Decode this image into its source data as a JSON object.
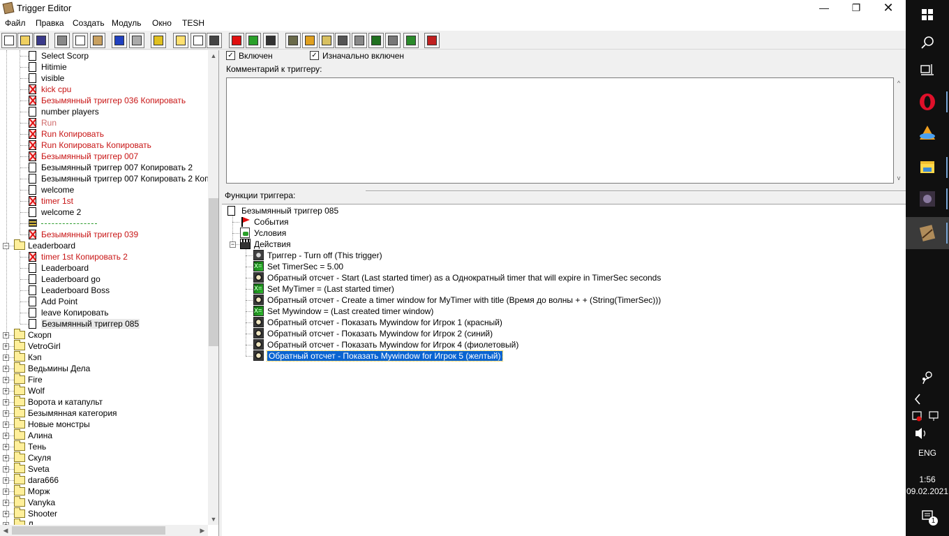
{
  "window": {
    "title": "Trigger Editor",
    "controls": {
      "minimize": "—",
      "maximize": "❐",
      "close": "✕"
    }
  },
  "menu": [
    "Файл",
    "Правка",
    "Создать",
    "Модуль",
    "Окно",
    "TESH"
  ],
  "toolbar": [
    "new",
    "open",
    "save",
    "cut",
    "copy",
    "paste",
    "undo",
    "redo",
    "delete",
    "new-category",
    "new-trigger",
    "new-comment",
    "new-event",
    "new-condition",
    "new-action",
    "terrain-editor",
    "trigger-editor",
    "sound-editor",
    "object-editor",
    "campaign-editor",
    "ai-editor",
    "object-manager",
    "import-manager",
    "test-map"
  ],
  "tree": {
    "items": [
      {
        "label": "Select Scorp",
        "type": "trigger",
        "depth": 2
      },
      {
        "label": "Hitimie",
        "type": "trigger",
        "depth": 2
      },
      {
        "label": "visible",
        "type": "trigger",
        "depth": 2
      },
      {
        "label": "kick cpu",
        "type": "trigger-off",
        "depth": 2
      },
      {
        "label": "Безымянный триггер 036 Копировать",
        "type": "trigger-off",
        "depth": 2
      },
      {
        "label": "number players",
        "type": "trigger",
        "depth": 2
      },
      {
        "label": "Run",
        "type": "trigger-disabled",
        "depth": 2
      },
      {
        "label": "Run Копировать",
        "type": "trigger-off",
        "depth": 2
      },
      {
        "label": "Run Копировать Копировать",
        "type": "trigger-off",
        "depth": 2
      },
      {
        "label": "Безымянный триггер 007",
        "type": "trigger-off",
        "depth": 2
      },
      {
        "label": "Безымянный триггер 007 Копировать 2",
        "type": "trigger",
        "depth": 2
      },
      {
        "label": "Безымянный триггер 007 Копировать 2 Копир",
        "type": "trigger",
        "depth": 2
      },
      {
        "label": "welcome",
        "type": "trigger",
        "depth": 2
      },
      {
        "label": "timer 1st",
        "type": "trigger-off",
        "depth": 2
      },
      {
        "label": "welcome 2",
        "type": "trigger",
        "depth": 2
      },
      {
        "label": "",
        "type": "separator",
        "depth": 2
      },
      {
        "label": "Безымянный триггер 039",
        "type": "trigger-off",
        "depth": 2
      },
      {
        "label": "Leaderboard",
        "type": "folder-open",
        "depth": 1
      },
      {
        "label": "timer 1st Копировать 2",
        "type": "trigger-off",
        "depth": 2
      },
      {
        "label": "Leaderboard",
        "type": "trigger",
        "depth": 2
      },
      {
        "label": "Leaderboard   go",
        "type": "trigger",
        "depth": 2
      },
      {
        "label": "Leaderboard   Boss",
        "type": "trigger",
        "depth": 2
      },
      {
        "label": "Add Point",
        "type": "trigger",
        "depth": 2
      },
      {
        "label": "leave Копировать",
        "type": "trigger",
        "depth": 2
      },
      {
        "label": "Безымянный триггер 085",
        "type": "trigger-selected",
        "depth": 2
      },
      {
        "label": "Скорп",
        "type": "folder",
        "depth": 1
      },
      {
        "label": "VetroGirl",
        "type": "folder",
        "depth": 1
      },
      {
        "label": "Кэп",
        "type": "folder",
        "depth": 1
      },
      {
        "label": "Ведьмины Дела",
        "type": "folder",
        "depth": 1
      },
      {
        "label": "Fire",
        "type": "folder",
        "depth": 1
      },
      {
        "label": "Wolf",
        "type": "folder",
        "depth": 1
      },
      {
        "label": "Ворота и катапульт",
        "type": "folder",
        "depth": 1
      },
      {
        "label": "Безымянная категория",
        "type": "folder",
        "depth": 1
      },
      {
        "label": "Новые монстры",
        "type": "folder",
        "depth": 1
      },
      {
        "label": "Алина",
        "type": "folder",
        "depth": 1
      },
      {
        "label": "Тень",
        "type": "folder",
        "depth": 1
      },
      {
        "label": "Скуля",
        "type": "folder",
        "depth": 1
      },
      {
        "label": "Sveta",
        "type": "folder",
        "depth": 1
      },
      {
        "label": "dara666",
        "type": "folder",
        "depth": 1
      },
      {
        "label": "Морж",
        "type": "folder",
        "depth": 1
      },
      {
        "label": "Vanyka",
        "type": "folder",
        "depth": 1
      },
      {
        "label": "Shooter",
        "type": "folder",
        "depth": 1
      },
      {
        "label": "Л...",
        "type": "folder",
        "depth": 1
      }
    ]
  },
  "trigger": {
    "enabled_label": "Включен",
    "initially_on_label": "Изначально включен",
    "comment_label": "Комментарий к триггеру:",
    "comment_value": "",
    "functions_label": "Функции триггера:",
    "name": "Безымянный триггер 085",
    "events_label": "События",
    "conditions_label": "Условия",
    "actions_label": "Действия",
    "actions": [
      {
        "icon": "trigger",
        "text": "Триггер - Turn off (This trigger)"
      },
      {
        "icon": "set",
        "text": "Set TimerSec = 5.00"
      },
      {
        "icon": "timer",
        "text": "Обратный отсчет - Start (Last started timer) as a Однократный timer that will expire in TimerSec seconds"
      },
      {
        "icon": "set",
        "text": "Set MyTimer = (Last started timer)"
      },
      {
        "icon": "timer",
        "text": "Обратный отсчет - Create a timer window for MyTimer with title (Время до волны       + + (String(TimerSec)))"
      },
      {
        "icon": "set",
        "text": "Set Mywindow = (Last created timer window)"
      },
      {
        "icon": "timer",
        "text": "Обратный отсчет - Показать Mywindow for Игрок 1 (красный)"
      },
      {
        "icon": "timer",
        "text": "Обратный отсчет - Показать Mywindow for Игрок 2 (синий)"
      },
      {
        "icon": "timer",
        "text": "Обратный отсчет - Показать Mywindow for Игрок 4 (фиолетовый)"
      },
      {
        "icon": "timer",
        "text": "Обратный отсчет - Показать Mywindow for Игрок 5 (желтый)",
        "selected": true
      }
    ]
  },
  "taskbar": {
    "language": "ENG",
    "time": "1:56",
    "date": "09.02.2021",
    "notifications": "1"
  },
  "colors": {
    "disabled_trigger": "#c81414",
    "selection": "#0a64d2",
    "taskbar": "#101010"
  }
}
